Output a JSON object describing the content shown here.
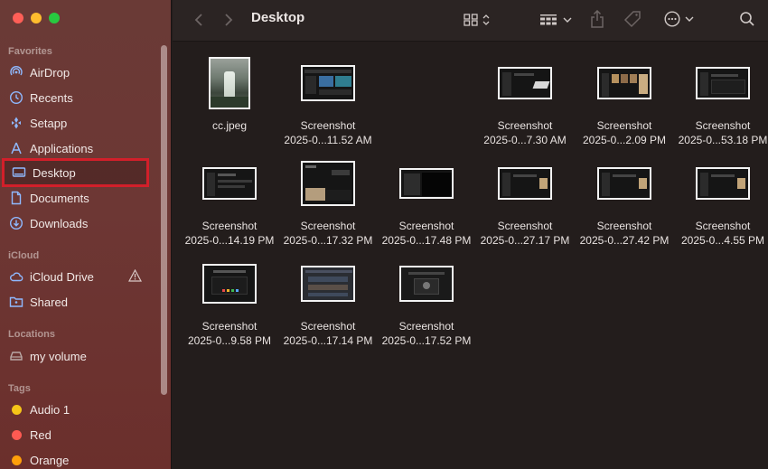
{
  "window": {
    "title": "Desktop"
  },
  "sidebar": {
    "favorites_title": "Favorites",
    "favorites": [
      {
        "label": "AirDrop",
        "icon": "airdrop-icon"
      },
      {
        "label": "Recents",
        "icon": "clock-icon"
      },
      {
        "label": "Setapp",
        "icon": "setapp-icon"
      },
      {
        "label": "Applications",
        "icon": "applications-icon"
      },
      {
        "label": "Desktop",
        "icon": "desktop-icon",
        "selected": true
      },
      {
        "label": "Documents",
        "icon": "document-icon"
      },
      {
        "label": "Downloads",
        "icon": "download-icon"
      }
    ],
    "icloud_title": "iCloud",
    "icloud": [
      {
        "label": "iCloud Drive",
        "icon": "cloud-icon",
        "warning": true
      },
      {
        "label": "Shared",
        "icon": "shared-folder-icon"
      }
    ],
    "locations_title": "Locations",
    "locations": [
      {
        "label": "my volume",
        "icon": "disk-icon"
      }
    ],
    "tags_title": "Tags",
    "tags": [
      {
        "label": "Audio 1",
        "color": "#f5c518"
      },
      {
        "label": "Red",
        "color": "#ff5a52"
      },
      {
        "label": "Orange",
        "color": "#ff9f0a"
      }
    ]
  },
  "files": [
    {
      "line1": "cc.jpeg",
      "line2": "",
      "kind": "photo"
    },
    {
      "line1": "Screenshot",
      "line2": "2025-0...11.52 AM",
      "kind": "shot-a"
    },
    {
      "line1": "",
      "line2": "",
      "kind": "blank"
    },
    {
      "line1": "Screenshot",
      "line2": "2025-0...7.30 AM",
      "kind": "shot-b"
    },
    {
      "line1": "Screenshot",
      "line2": "2025-0...2.09 PM",
      "kind": "shot-c"
    },
    {
      "line1": "Screenshot",
      "line2": "2025-0...53.18 PM",
      "kind": "shot-d"
    },
    {
      "line1": "Screenshot",
      "line2": "2025-0...14.19 PM",
      "kind": "shot-e"
    },
    {
      "line1": "Screenshot",
      "line2": "2025-0...17.32 PM",
      "kind": "shot-f"
    },
    {
      "line1": "Screenshot",
      "line2": "2025-0...17.48 PM",
      "kind": "shot-g"
    },
    {
      "line1": "Screenshot",
      "line2": "2025-0...27.17 PM",
      "kind": "shot-h"
    },
    {
      "line1": "Screenshot",
      "line2": "2025-0...27.42 PM",
      "kind": "shot-h"
    },
    {
      "line1": "Screenshot",
      "line2": "2025-0...4.55 PM",
      "kind": "shot-h"
    },
    {
      "line1": "Screenshot",
      "line2": "2025-0...9.58 PM",
      "kind": "shot-i"
    },
    {
      "line1": "Screenshot",
      "line2": "2025-0...17.14 PM",
      "kind": "shot-j"
    },
    {
      "line1": "Screenshot",
      "line2": "2025-0...17.52 PM",
      "kind": "shot-k"
    }
  ]
}
